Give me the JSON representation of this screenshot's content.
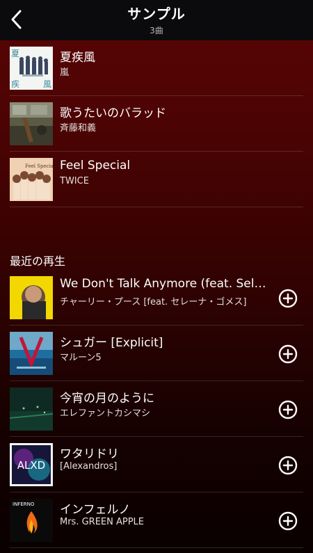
{
  "header": {
    "title": "サンプル",
    "subtitle": "3曲",
    "back_icon": "chevron-left-icon"
  },
  "playlist": [
    {
      "title": "夏疾風",
      "artist": "嵐"
    },
    {
      "title": "歌うたいのバラッド",
      "artist": "斉藤和義"
    },
    {
      "title": "Feel Special",
      "artist": "TWICE"
    }
  ],
  "recent": {
    "heading": "最近の再生",
    "items": [
      {
        "title": "We Don't Talk Anymore (feat. Selen...",
        "artist": "チャーリー・プース [feat. セレーナ・ゴメス]"
      },
      {
        "title": "シュガー [Explicit]",
        "artist": "マルーン5"
      },
      {
        "title": "今宵の月のように",
        "artist": "エレファントカシマシ"
      },
      {
        "title": "ワタリドリ",
        "artist": "[Alexandros]"
      },
      {
        "title": "インフェルノ",
        "artist": "Mrs. GREEN APPLE"
      }
    ]
  },
  "art_text": {
    "a1": [
      "夏",
      "疾",
      "風"
    ],
    "a3": "Feel Special",
    "a7": "ALXD",
    "a8": "INFERNO"
  },
  "colors": {
    "background_top": "#5a0505",
    "header_bg": "#0b0b0e",
    "add_icon": "#ffffff"
  }
}
